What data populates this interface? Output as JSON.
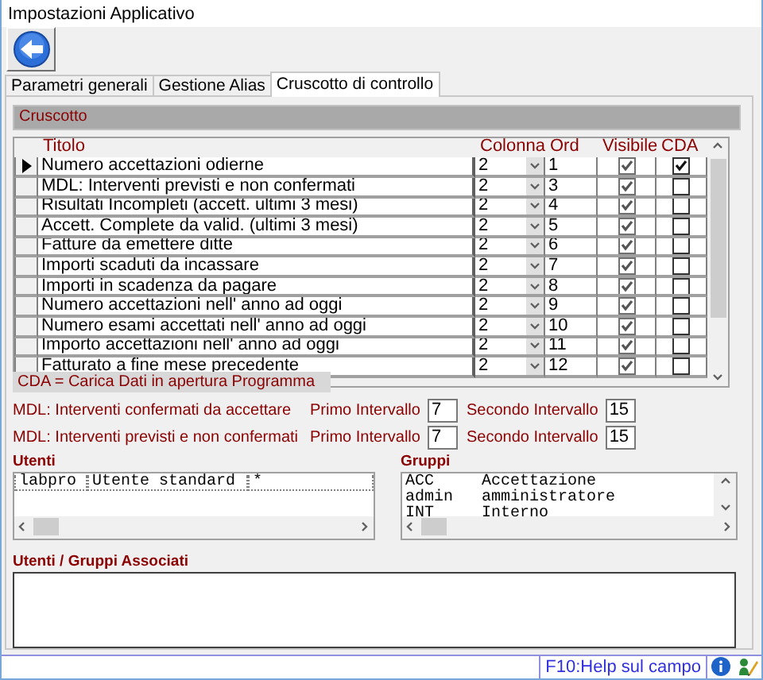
{
  "window": {
    "title": "Impostazioni Applicativo"
  },
  "tabs": [
    {
      "label": "Parametri generali",
      "selected": false
    },
    {
      "label": "Gestione Alias",
      "selected": false
    },
    {
      "label": "Cruscotto di controllo",
      "selected": true
    }
  ],
  "section_header": "Cruscotto",
  "grid": {
    "columns": [
      "Titolo",
      "Colonna",
      "Ord",
      "Visibile",
      "CDA"
    ],
    "rows": [
      {
        "selected": true,
        "title": "Numero accettazioni odierne",
        "colonna": "2",
        "ord": "1",
        "visible": true,
        "cda": true
      },
      {
        "selected": false,
        "title": "MDL: Interventi previsti e non confermati",
        "colonna": "2",
        "ord": "3",
        "visible": true,
        "cda": false
      },
      {
        "selected": false,
        "title": "Risultati Incompleti (accett. ultimi 3 mesi)",
        "colonna": "2",
        "ord": "4",
        "visible": true,
        "cda": false
      },
      {
        "selected": false,
        "title": "Accett. Complete da valid. (ultimi 3 mesi)",
        "colonna": "2",
        "ord": "5",
        "visible": true,
        "cda": false
      },
      {
        "selected": false,
        "title": "Fatture da emettere ditte",
        "colonna": "2",
        "ord": "6",
        "visible": true,
        "cda": false
      },
      {
        "selected": false,
        "title": "Importi scaduti da incassare",
        "colonna": "2",
        "ord": "7",
        "visible": true,
        "cda": false
      },
      {
        "selected": false,
        "title": "Importi in scadenza da pagare",
        "colonna": "2",
        "ord": "8",
        "visible": true,
        "cda": false
      },
      {
        "selected": false,
        "title": "Numero accettazioni nell' anno ad oggi",
        "colonna": "2",
        "ord": "9",
        "visible": true,
        "cda": false
      },
      {
        "selected": false,
        "title": "Numero esami accettati nell' anno ad oggi",
        "colonna": "2",
        "ord": "10",
        "visible": true,
        "cda": false
      },
      {
        "selected": false,
        "title": "Importo accettazioni nell' anno ad oggi",
        "colonna": "2",
        "ord": "11",
        "visible": true,
        "cda": false
      },
      {
        "selected": false,
        "title": "Fatturato a fine mese precedente",
        "colonna": "2",
        "ord": "12",
        "visible": true,
        "cda": false
      }
    ]
  },
  "cda_note": "CDA = Carica Dati in apertura Programma",
  "intervals": [
    {
      "label": "MDL: Interventi confermati da accettare",
      "first_label": "Primo Intervallo",
      "first": "7",
      "second_label": "Secondo Intervallo",
      "second": "15"
    },
    {
      "label": "MDL: Interventi previsti e non confermati",
      "first_label": "Primo Intervallo",
      "first": "7",
      "second_label": "Secondo Intervallo",
      "second": "15"
    }
  ],
  "utenti": {
    "label": "Utenti",
    "rows": [
      [
        "labpro",
        "Utente standard",
        "*"
      ]
    ]
  },
  "gruppi": {
    "label": "Gruppi",
    "rows": [
      [
        "ACC",
        "Accettazione"
      ],
      [
        "admin",
        "amministratore"
      ],
      [
        "INT",
        "Interno"
      ]
    ]
  },
  "associati": {
    "label": "Utenti / Gruppi Associati"
  },
  "status_bar": {
    "help": "F10:Help sul campo"
  }
}
